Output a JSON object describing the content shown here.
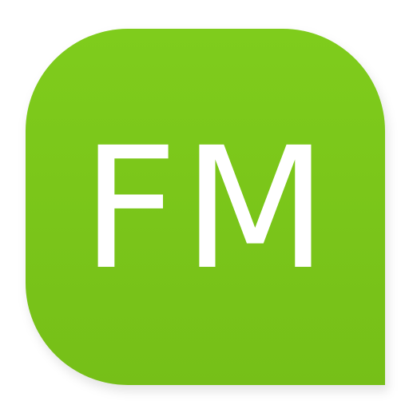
{
  "icon": {
    "label": "FM",
    "background_color": "#7dc91a",
    "text_color": "#ffffff"
  }
}
